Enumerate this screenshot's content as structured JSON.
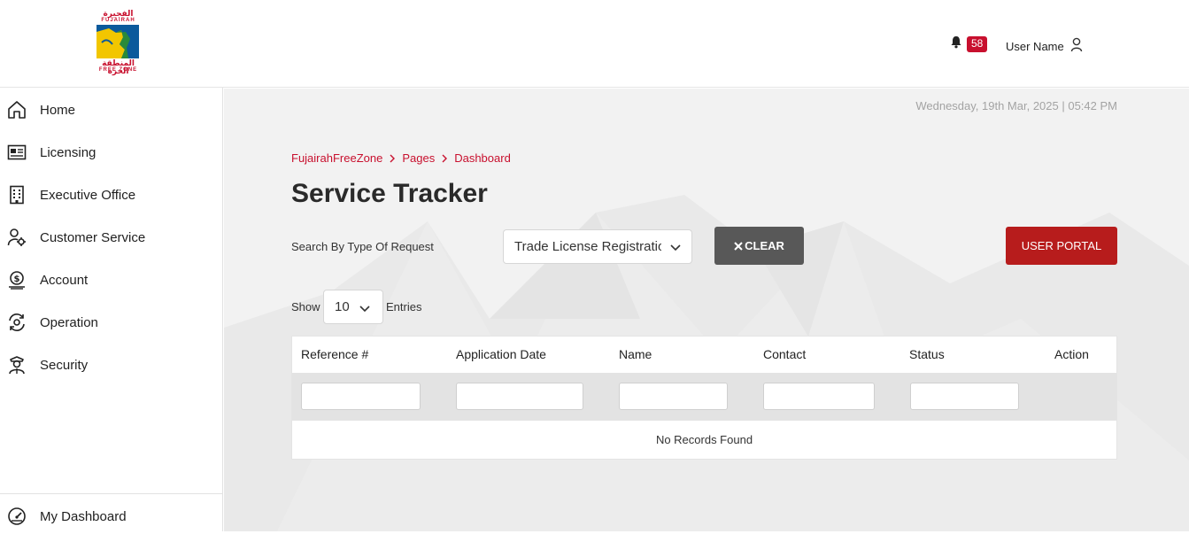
{
  "header": {
    "logo": {
      "arabic": "الفجيرة",
      "name": "FUJAIRAH",
      "arabic_sub": "المنطقة الحرة",
      "sub": "FREE ZONE"
    },
    "notifications": {
      "icon": "bell-icon",
      "count": "58"
    },
    "user": {
      "name": "User Name",
      "icon": "user-icon"
    }
  },
  "sidebar": {
    "items": [
      {
        "label": "Home",
        "icon": "home-icon"
      },
      {
        "label": "Licensing",
        "icon": "id-card-icon"
      },
      {
        "label": "Executive Office",
        "icon": "building-icon"
      },
      {
        "label": "Customer Service",
        "icon": "user-gear-icon"
      },
      {
        "label": "Account",
        "icon": "money-icon"
      },
      {
        "label": "Operation",
        "icon": "cycle-gear-icon"
      },
      {
        "label": "Security",
        "icon": "guard-icon"
      }
    ],
    "footer_item": {
      "label": "My Dashboard",
      "icon": "dashboard-icon"
    }
  },
  "main": {
    "datetime": "Wednesday, 19th Mar, 2025 | 05:42 PM",
    "breadcrumb": [
      "FujairahFreeZone",
      "Pages",
      "Dashboard"
    ],
    "title": "Service Tracker",
    "filter": {
      "label": "Search By Type Of Request",
      "selected": "Trade License Registration",
      "clear_label": "CLEAR",
      "portal_label": "USER PORTAL"
    },
    "paging": {
      "show_label": "Show",
      "page_size": "10",
      "entries_label": "Entries"
    },
    "table": {
      "columns": [
        "Reference #",
        "Application Date",
        "Name",
        "Contact",
        "Status",
        "Action"
      ],
      "empty_message": "No Records Found"
    }
  },
  "colors": {
    "brand_red": "#c8102e",
    "button_red": "#b71c1c",
    "button_gray": "#585858"
  }
}
